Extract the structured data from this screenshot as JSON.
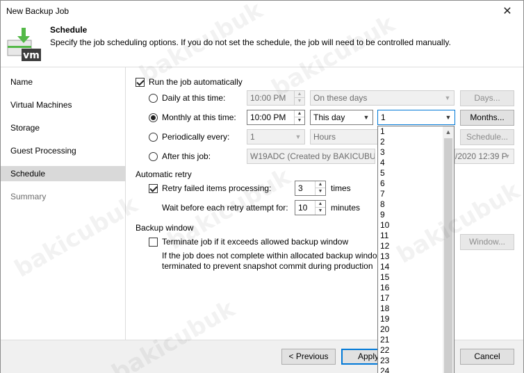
{
  "window": {
    "title": "New Backup Job",
    "close_glyph": "✕"
  },
  "header": {
    "title": "Schedule",
    "description": "Specify the job scheduling options. If you do not set the schedule, the job will need to be controlled manually.",
    "logo_text": "vm"
  },
  "sidebar": {
    "items": [
      {
        "label": "Name",
        "state": "normal"
      },
      {
        "label": "Virtual Machines",
        "state": "normal"
      },
      {
        "label": "Storage",
        "state": "normal"
      },
      {
        "label": "Guest Processing",
        "state": "normal"
      },
      {
        "label": "Schedule",
        "state": "active"
      },
      {
        "label": "Summary",
        "state": "disabled"
      }
    ]
  },
  "schedule": {
    "run_auto_label": "Run the job automatically",
    "run_auto_checked": true,
    "daily": {
      "label": "Daily at this time:",
      "time": "10:00 PM",
      "days": "On these days",
      "button": "Days...",
      "selected": false
    },
    "monthly": {
      "label": "Monthly at this time:",
      "time": "10:00 PM",
      "day_type": "This day",
      "day_value": "1",
      "button": "Months...",
      "selected": true
    },
    "periodic": {
      "label": "Periodically every:",
      "value": "1",
      "unit": "Hours",
      "button": "Schedule...",
      "selected": false
    },
    "after": {
      "label": "After this job:",
      "job": "W19ADC (Created by BAKICUBUK\\...",
      "job_date_tail": "/2020 12:39 P",
      "selected": false
    }
  },
  "retry": {
    "section_label": "Automatic retry",
    "retry_label": "Retry failed items processing:",
    "retry_checked": true,
    "retry_count": "3",
    "retry_unit": "times",
    "wait_label": "Wait before each retry attempt for:",
    "wait_value": "10",
    "wait_unit": "minutes"
  },
  "backup_window": {
    "section_label": "Backup window",
    "terminate_label": "Terminate job if it exceeds allowed backup window",
    "terminate_checked": false,
    "note_line1": "If the job does not complete within allocated backup windo",
    "note_line2": "terminated to prevent snapshot commit during production",
    "button": "Window..."
  },
  "day_list": [
    "1",
    "2",
    "3",
    "4",
    "5",
    "6",
    "7",
    "8",
    "9",
    "10",
    "11",
    "12",
    "13",
    "14",
    "15",
    "16",
    "17",
    "18",
    "19",
    "20",
    "21",
    "22",
    "23",
    "24"
  ],
  "footer": {
    "previous": "< Previous",
    "apply": "Apply",
    "cancel": "Cancel"
  },
  "watermark_text": "bakicubuk"
}
